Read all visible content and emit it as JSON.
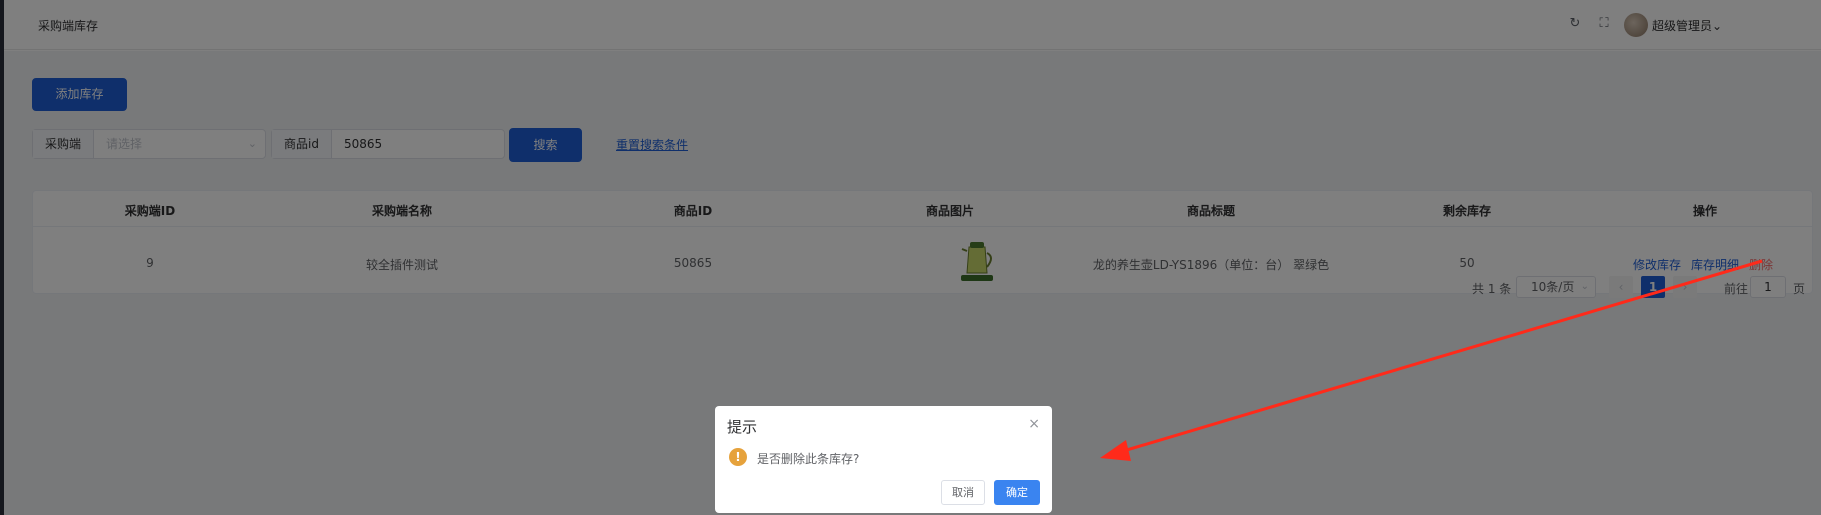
{
  "header": {
    "title": "采购端库存",
    "user": "超级管理员",
    "refresh_icon": "↻",
    "fullscreen_icon": "⛶",
    "chevron": "⌄"
  },
  "toolbar": {
    "add_label": "添加库存",
    "search_label": "搜索",
    "reset_label": "重置搜索条件"
  },
  "filters": {
    "purchaser_label": "采购端",
    "purchaser_placeholder": "请选择",
    "product_id_label": "商品id",
    "product_id_value": "50865"
  },
  "table": {
    "columns": [
      "采购端ID",
      "采购端名称",
      "商品ID",
      "商品图片",
      "商品标题",
      "剩余库存",
      "操作"
    ],
    "rows": [
      {
        "purchaser_id": "9",
        "purchaser_name": "较全插件测试",
        "product_id": "50865",
        "title": "龙的养生壶LD-YS1896（单位：台） 翠绿色",
        "stock": "50",
        "actions": [
          "修改库存",
          "库存明细",
          "删除"
        ]
      }
    ]
  },
  "pagination": {
    "total": "共 1 条",
    "page_size": "10条/页",
    "prev": "‹",
    "current": "1",
    "next": "›",
    "goto_label": "前往",
    "goto_value": "1",
    "goto_unit": "页"
  },
  "dialog": {
    "title": "提示",
    "message": "是否删除此条库存?",
    "warn_icon": "!",
    "close_icon": "×",
    "cancel_label": "取消",
    "confirm_label": "确定"
  },
  "colors": {
    "primary": "#1f5fd6",
    "danger": "#f56c6c",
    "warning": "#e6a23c",
    "annotation_arrow": "#ff2a1a"
  }
}
